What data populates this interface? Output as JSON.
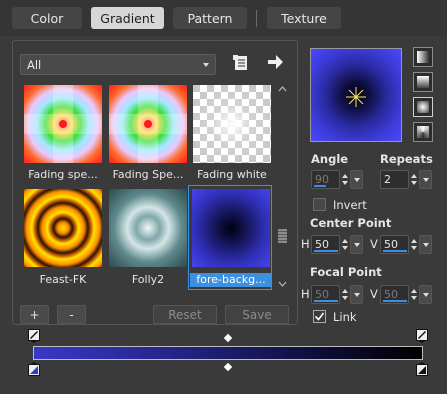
{
  "tabs": [
    {
      "label": "Color"
    },
    {
      "label": "Gradient"
    },
    {
      "label": "Pattern"
    },
    {
      "label": "Texture"
    }
  ],
  "category_select": {
    "value": "All"
  },
  "gradients": [
    {
      "label": "Fading spe..."
    },
    {
      "label": "Fading Spe..."
    },
    {
      "label": "Fading white"
    },
    {
      "label": "Feast-FK"
    },
    {
      "label": "Folly2"
    },
    {
      "label": "fore-backg..."
    }
  ],
  "buttons": {
    "add": "+",
    "remove": "-",
    "reset": "Reset",
    "save": "Save"
  },
  "settings": {
    "angle_label": "Angle",
    "angle_value": "90",
    "repeats_label": "Repeats",
    "repeats_value": "2",
    "invert_label": "Invert",
    "center_point_label": "Center Point",
    "center_h_label": "H",
    "center_h_value": "50",
    "center_v_label": "V",
    "center_v_value": "50",
    "focal_point_label": "Focal Point",
    "focal_h_label": "H",
    "focal_h_value": "50",
    "focal_v_label": "V",
    "focal_v_value": "50",
    "link_label": "Link"
  },
  "colors": {
    "accent": "#3d8fe0",
    "gradient_start": "#3838c8",
    "gradient_end": "#000000"
  }
}
